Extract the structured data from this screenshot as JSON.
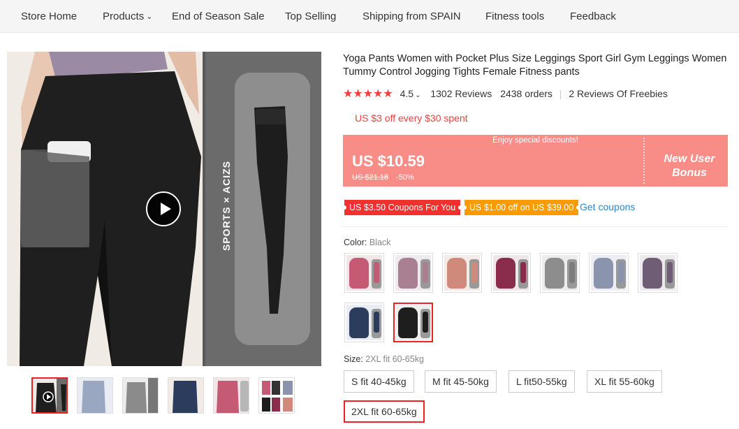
{
  "nav": {
    "items": [
      "Store Home",
      "Products",
      "End of Season Sale",
      "Top Selling",
      "Shipping from SPAIN",
      "Fitness tools",
      "Feedback"
    ]
  },
  "gallery": {
    "brand_text": "SPORTS × ACIZS"
  },
  "product": {
    "title": "Yoga Pants Women with Pocket Plus Size Leggings Sport Girl Gym Leggings Women Tummy Control Jogging Tights Female Fitness pants",
    "stars": "★★★★★",
    "rating": "4.5",
    "reviews": "1302 Reviews",
    "orders": "2438 orders",
    "freebies": "2 Reviews Of Freebies",
    "promo": "US $3 off every $30 spent"
  },
  "price_box": {
    "enjoy": "Enjoy special discounts!",
    "price": "US $10.59",
    "original": "US $21.18",
    "discount": "-50%",
    "bonus": "New User Bonus"
  },
  "coupons": {
    "c1": "US $3.50 Coupons For You",
    "c2": "US $1.00 off on US $39.00",
    "get": "Get coupons"
  },
  "color": {
    "label": "Color:",
    "value": "Black",
    "swatches": [
      "#c45a73",
      "#a98092",
      "#d08a7c",
      "#8a2c4c",
      "#8d8d8d",
      "#8a95ad",
      "#6e5d75",
      "#2c3c5c",
      "#1e1e1e"
    ]
  },
  "size": {
    "label": "Size:",
    "value": "2XL fit 60-65kg",
    "options": [
      "S fit 40-45kg",
      "M fit 45-50kg",
      "L fit50-55kg",
      "XL fit 55-60kg",
      "2XL fit 60-65kg"
    ]
  }
}
